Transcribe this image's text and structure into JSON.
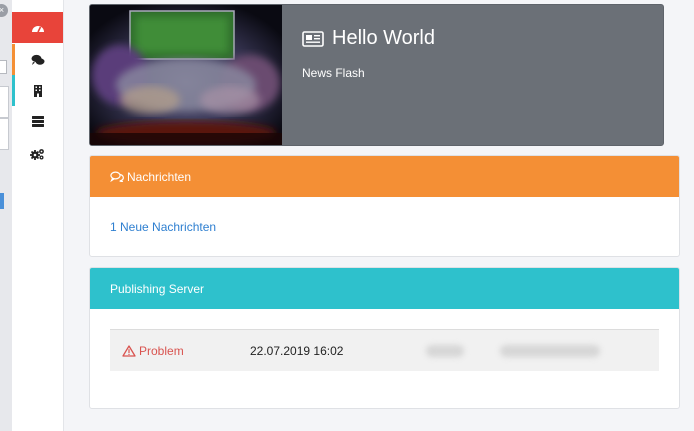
{
  "hero": {
    "title": "Hello World",
    "subtitle": "News Flash"
  },
  "messages": {
    "header": "Nachrichten",
    "link": "1 Neue Nachrichten"
  },
  "publishing": {
    "header": "Publishing Server",
    "status": "Problem",
    "date": "22.07.2019 16:02"
  },
  "sidebar": {
    "items": [
      "dashboard-icon",
      "chat-icon",
      "building-icon",
      "server-icon",
      "cogs-icon"
    ]
  },
  "colors": {
    "sidebar_active": "#e8443a",
    "orange": "#f48f35",
    "teal": "#2ec1cc",
    "danger": "#d9534f",
    "link": "#2e7fd0",
    "hero_bg": "#6b7077"
  }
}
